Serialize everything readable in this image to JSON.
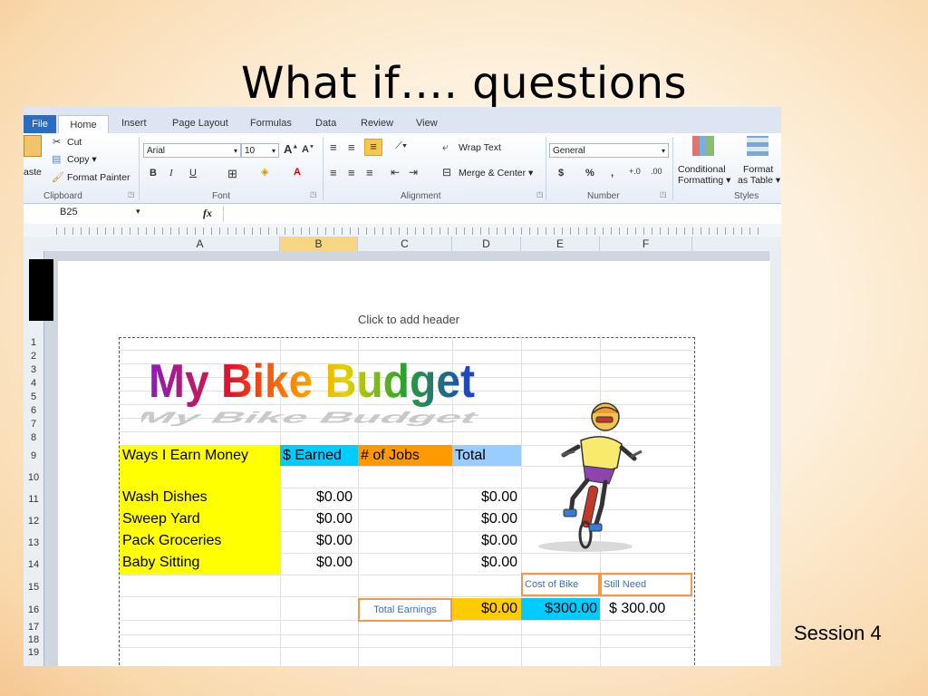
{
  "slide": {
    "title": "What if…. questions",
    "footer": "Session 4"
  },
  "ribbon": {
    "tabs": [
      "File",
      "Home",
      "Insert",
      "Page Layout",
      "Formulas",
      "Data",
      "Review",
      "View"
    ],
    "clipboard": {
      "cut": "Cut",
      "copy": "Copy ▾",
      "format_painter": "Format Painter",
      "paste": "aste",
      "group": "Clipboard"
    },
    "font": {
      "name": "Arial",
      "size": "10",
      "group": "Font",
      "bold": "B",
      "italic": "I",
      "underline": "U"
    },
    "alignment": {
      "wrap": "Wrap Text",
      "merge": "Merge & Center ▾",
      "group": "Alignment"
    },
    "number": {
      "format": "General",
      "group": "Number",
      "currency": "$",
      "percent": "%",
      "comma": ","
    },
    "styles": {
      "conditional": "Conditional",
      "formatting": "Formatting ▾",
      "format": "Format",
      "as_table": "as Table ▾",
      "group": "Styles"
    }
  },
  "formula_bar": {
    "name_box": "B25",
    "fx": "fx",
    "value": ""
  },
  "columns": [
    "A",
    "B",
    "C",
    "D",
    "E",
    "F"
  ],
  "rows": [
    "1",
    "2",
    "3",
    "4",
    "5",
    "6",
    "7",
    "8",
    "9",
    "10",
    "11",
    "12",
    "13",
    "14",
    "15",
    "16",
    "17",
    "18",
    "19"
  ],
  "page_header": "Click to add header",
  "sheet": {
    "title": "My Bike Budget",
    "headers": {
      "ways": "Ways I Earn Money",
      "earned": "$ Earned",
      "jobs": "# of Jobs",
      "total": "Total"
    },
    "jobs": [
      {
        "name": "Wash Dishes",
        "earned": "$0.00",
        "total": "$0.00"
      },
      {
        "name": "Sweep Yard",
        "earned": "$0.00",
        "total": "$0.00"
      },
      {
        "name": "Pack Groceries",
        "earned": "$0.00",
        "total": "$0.00"
      },
      {
        "name": "Baby Sitting",
        "earned": "$0.00",
        "total": "$0.00"
      }
    ],
    "cost_label": "Cost of Bike",
    "still_label": "Still Need",
    "total_earnings_label": "Total Earnings",
    "total_earnings": "$0.00",
    "cost": "$300.00",
    "still_need": "$ 300.00"
  },
  "colors": {
    "yellow": "#ffff00",
    "blue": "#99ccff",
    "orange": "#ff9900",
    "cyan": "#00ccff",
    "gold": "#ffcc00",
    "border_orange": "#f79646"
  }
}
